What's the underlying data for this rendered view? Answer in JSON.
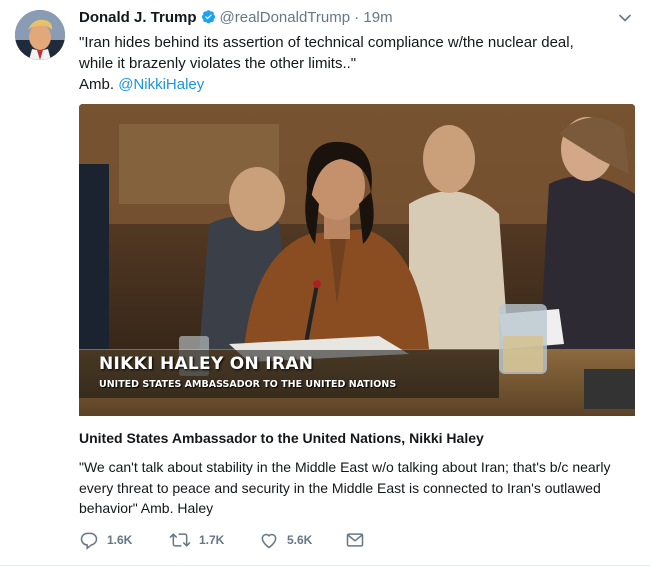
{
  "tweet": {
    "author": {
      "name": "Donald J. Trump",
      "handle": "@realDonaldTrump",
      "verified_icon": "verified-badge-icon"
    },
    "separator": "·",
    "time": "19m",
    "text": {
      "line1": "\"Iran hides behind its assertion of technical compliance w/the nuclear deal,",
      "line2": "while it brazenly violates the other limits..\"",
      "attribution_prefix": "Amb. ",
      "mention": "@NikkiHaley"
    },
    "card": {
      "lower_third_name": "NIKKI HALEY ON IRAN",
      "lower_third_role": "UNITED STATES AMBASSADOR TO THE UNITED NATIONS",
      "title": "United States Ambassador to the United Nations, Nikki Haley",
      "description": "\"We can't talk about stability in the Middle East w/o talking about Iran; that's b/c nearly every threat to peace and security in the Middle East is connected to Iran's outlawed behavior\" Amb. Haley"
    },
    "actions": {
      "reply_count": "1.6K",
      "retweet_count": "1.7K",
      "like_count": "5.6K",
      "icons": [
        "reply-icon",
        "retweet-icon",
        "like-icon",
        "direct-message-icon"
      ]
    }
  },
  "colors": {
    "link": "#1b95e0",
    "secondary_text": "#657786",
    "primary_text": "#14171a",
    "verified": "#1da1f2"
  }
}
